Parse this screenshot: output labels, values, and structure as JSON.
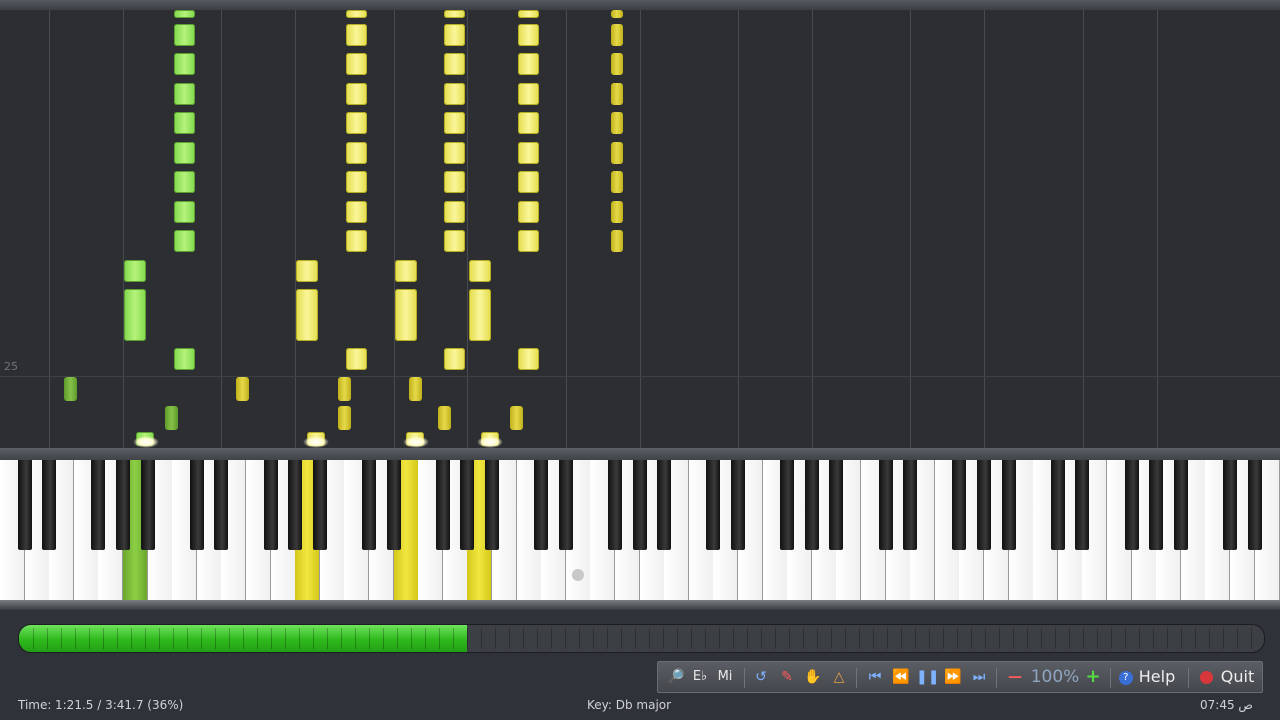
{
  "piano_roll": {
    "measure_number": "25"
  },
  "progress": {
    "fraction": 0.36
  },
  "toolbar": {
    "key_signature_label": "E♭",
    "solfege_label": "Mi",
    "zoom_value": "100%",
    "help_label": "Help",
    "quit_label": "Quit"
  },
  "status": {
    "time_label": "Time:",
    "time_value": "1:21.5 / 3:41.7 (36%)",
    "key_text": "Key: Db major",
    "clock": "07:45 ص"
  },
  "colors": {
    "left_hand": "#7fd84a",
    "right_hand": "#f0ea6a",
    "progress_fill": "#2fb81e"
  }
}
